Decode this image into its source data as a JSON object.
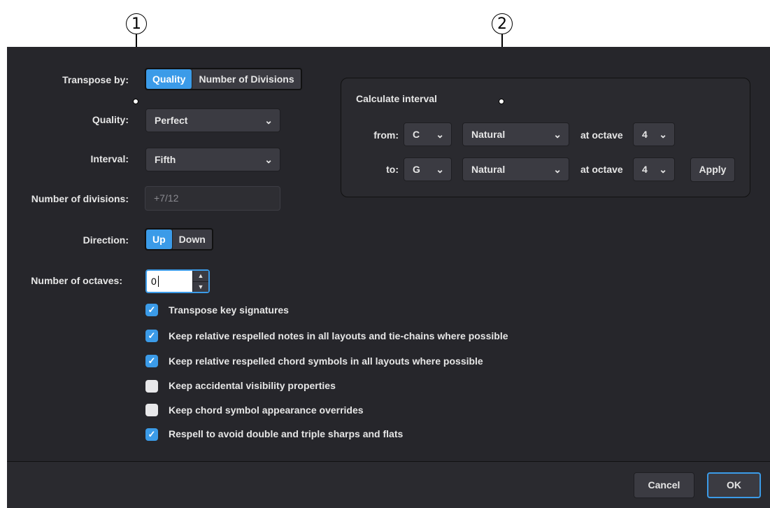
{
  "callouts": {
    "c1": "1",
    "c2": "2"
  },
  "transpose_by": {
    "label": "Transpose by:",
    "options": [
      "Quality",
      "Number of Divisions"
    ],
    "selected": "Quality"
  },
  "quality": {
    "label": "Quality:",
    "value": "Perfect"
  },
  "interval": {
    "label": "Interval:",
    "value": "Fifth"
  },
  "divisions": {
    "label": "Number of divisions:",
    "value": "+7/12"
  },
  "direction": {
    "label": "Direction:",
    "options": [
      "Up",
      "Down"
    ],
    "selected": "Up"
  },
  "octaves": {
    "label": "Number of octaves:",
    "value": "0"
  },
  "checkboxes": [
    {
      "label": "Transpose key signatures",
      "checked": true
    },
    {
      "label": "Keep relative respelled notes in all layouts and tie-chains where possible",
      "checked": true
    },
    {
      "label": "Keep relative respelled chord symbols in all layouts where possible",
      "checked": true
    },
    {
      "label": "Keep accidental visibility properties",
      "checked": false
    },
    {
      "label": "Keep chord symbol appearance overrides",
      "checked": false
    },
    {
      "label": "Respell to avoid double and triple sharps and flats",
      "checked": true
    }
  ],
  "calc": {
    "title": "Calculate interval",
    "from": {
      "label": "from:",
      "note": "C",
      "accidental": "Natural",
      "octave_label": "at octave",
      "octave": "4"
    },
    "to": {
      "label": "to:",
      "note": "G",
      "accidental": "Natural",
      "octave_label": "at octave",
      "octave": "4"
    },
    "apply": "Apply"
  },
  "footer": {
    "cancel": "Cancel",
    "ok": "OK"
  },
  "glyphs": {
    "chevron": "⌄",
    "check": "✓",
    "up": "⌃",
    "down": "⌄"
  },
  "colors": {
    "accent": "#3b9be8",
    "dialog_bg": "#26262b",
    "control_bg": "#3b3b42"
  }
}
